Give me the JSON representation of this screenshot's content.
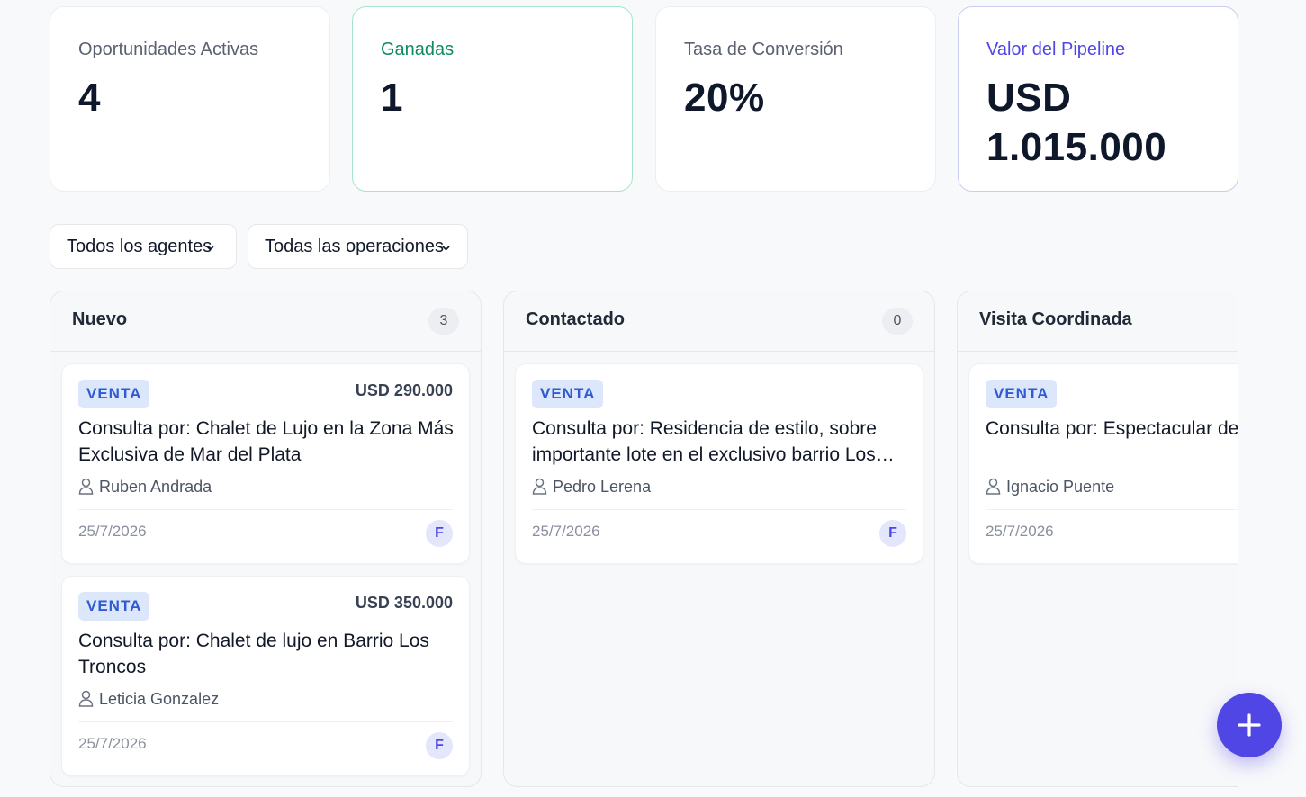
{
  "stats": {
    "active_label": "Oportunidades Activas",
    "active_value": "4",
    "won_label": "Ganadas",
    "won_value": "1",
    "conversion_label": "Tasa de Conversión",
    "conversion_value": "20%",
    "pipeline_label": "Valor del Pipeline",
    "pipeline_value": "USD 1.015.000"
  },
  "filters": {
    "agents_selected": "Todos los agentes",
    "operations_selected": "Todas las operaciones"
  },
  "columns": [
    {
      "title": "Nuevo",
      "count": "3",
      "cards": [
        {
          "badge": "VENTA",
          "price": "USD 290.000",
          "title": "Consulta por: Chalet de Lujo en la Zona Más Exclusiva de Mar del Plata",
          "agent": "Ruben Andrada",
          "date": "25/7/2026",
          "avatar": "F"
        },
        {
          "badge": "VENTA",
          "price": "USD 350.000",
          "title": "Consulta por: Chalet de lujo en Barrio Los Troncos",
          "agent": "Leticia Gonzalez",
          "date": "25/7/2026",
          "avatar": "F"
        }
      ]
    },
    {
      "title": "Contactado",
      "count": "0",
      "cards": [
        {
          "badge": "VENTA",
          "title": "Consulta por: Residencia de estilo, sobre importante lote en el exclusivo barrio Los…",
          "agent": "Pedro Lerena",
          "date": "25/7/2026",
          "avatar": "F"
        }
      ]
    },
    {
      "title": "Visita Coordinada",
      "cards": [
        {
          "badge": "VENTA",
          "title": "Consulta por: Espectacular de en Playa Chica",
          "agent": "Ignacio Puente",
          "date": "25/7/2026"
        }
      ]
    }
  ],
  "colors": {
    "accent": "#4f46e5",
    "won": "#0f8a5f",
    "badge_bg": "#dde7fb",
    "badge_text": "#2f5bd1"
  },
  "icons": {
    "agent": "user-icon",
    "add": "plus-icon",
    "dropdown": "chevron-down-icon"
  }
}
